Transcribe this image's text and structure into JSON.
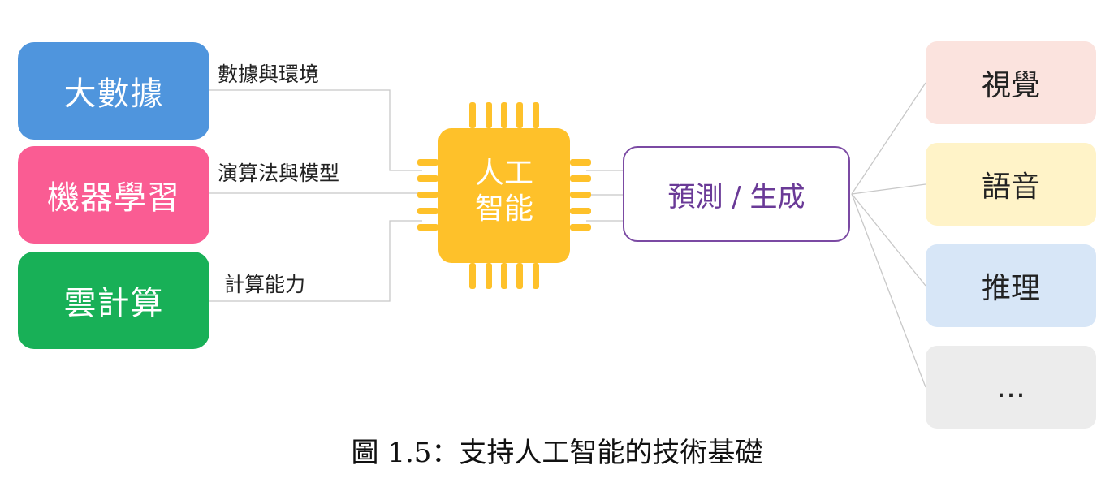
{
  "sources": [
    {
      "id": "big-data",
      "label": "大數據",
      "color": "#4f95dd",
      "edge_label": "數據與環境"
    },
    {
      "id": "machine-learning",
      "label": "機器學習",
      "color": "#fa5c93",
      "edge_label": "演算法與模型"
    },
    {
      "id": "cloud",
      "label": "雲計算",
      "color": "#18b057",
      "edge_label": "計算能力"
    }
  ],
  "core": {
    "line1": "人工",
    "line2": "智能",
    "color": "#fec12a",
    "icon": "cpu-chip-icon"
  },
  "prediction": {
    "label": "預測 / 生成",
    "border_color": "#7b4aa3"
  },
  "outputs": [
    {
      "label": "視覺",
      "color": "#fbe3de"
    },
    {
      "label": "語音",
      "color": "#fff3c8"
    },
    {
      "label": "推理",
      "color": "#d7e6f7"
    },
    {
      "label": "…",
      "color": "#ececec"
    }
  ],
  "caption": "圖 1.5：支持人工智能的技術基礎"
}
